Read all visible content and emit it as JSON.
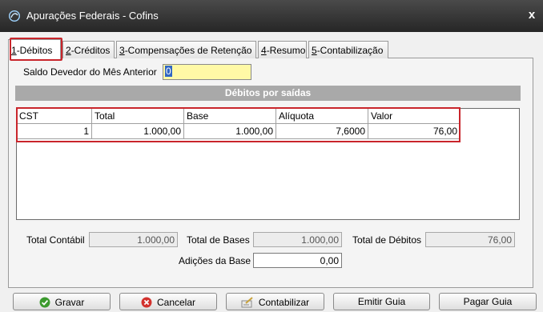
{
  "window": {
    "title": "Apurações Federais - Cofins",
    "close": "x"
  },
  "tabs": [
    {
      "key": "1",
      "rest": "-Débitos"
    },
    {
      "key": "2",
      "rest": "-Créditos"
    },
    {
      "key": "3",
      "rest": "-Compensações de Retenção"
    },
    {
      "key": "4",
      "rest": "-Resumo"
    },
    {
      "key": "5",
      "rest": "-Contabilização"
    }
  ],
  "saldo": {
    "label": "Saldo Devedor do Mês Anterior",
    "value": "0"
  },
  "section": {
    "title": "Débitos por saídas"
  },
  "grid": {
    "columns": [
      "CST",
      "Total",
      "Base",
      "Alíquota",
      "Valor"
    ],
    "rows": [
      [
        "1",
        "1.000,00",
        "1.000,00",
        "7,6000",
        "76,00"
      ]
    ]
  },
  "totals": {
    "contabil_label": "Total Contábil",
    "contabil_value": "1.000,00",
    "bases_label": "Total de Bases",
    "bases_value": "1.000,00",
    "debitos_label": "Total de Débitos",
    "debitos_value": "76,00",
    "adicoes_label": "Adições da Base",
    "adicoes_value": "0,00"
  },
  "buttons": {
    "gravar": "Gravar",
    "cancelar": "Cancelar",
    "contabilizar": "Contabilizar",
    "emitir": "Emitir Guia",
    "pagar": "Pagar Guia"
  },
  "colors": {
    "highlight": "#c9252b",
    "titlebar": "#2e2e2e",
    "section": "#a9a9a9",
    "input_yellow": "#fff9a6"
  }
}
